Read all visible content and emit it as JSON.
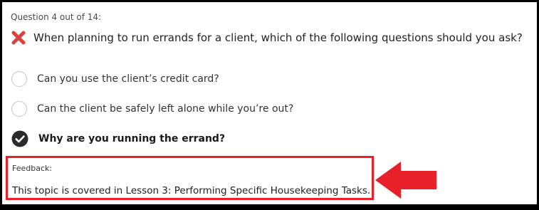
{
  "quiz": {
    "counter": "Question 4 out of 14:",
    "question_text": "When planning to run errands for a client, which of the following questions should you ask?",
    "result_icon": "x-mark-icon",
    "options": [
      {
        "label": "Can you use the client’s credit card?",
        "state": "unselected"
      },
      {
        "label": "Can the client be safely left alone while you’re out?",
        "state": "unselected"
      },
      {
        "label": "Why are you running the errand?",
        "state": "selected"
      }
    ]
  },
  "feedback": {
    "label": "Feedback:",
    "text": "This topic is covered in Lesson 3: Performing Specific Housekeeping Tasks."
  },
  "annotation": {
    "icon": "arrow-left-icon",
    "color": "#e8202a"
  },
  "colors": {
    "wrong_mark": "#d9443f",
    "selected_check": "#2b2b2b",
    "highlight": "#e8202a"
  }
}
